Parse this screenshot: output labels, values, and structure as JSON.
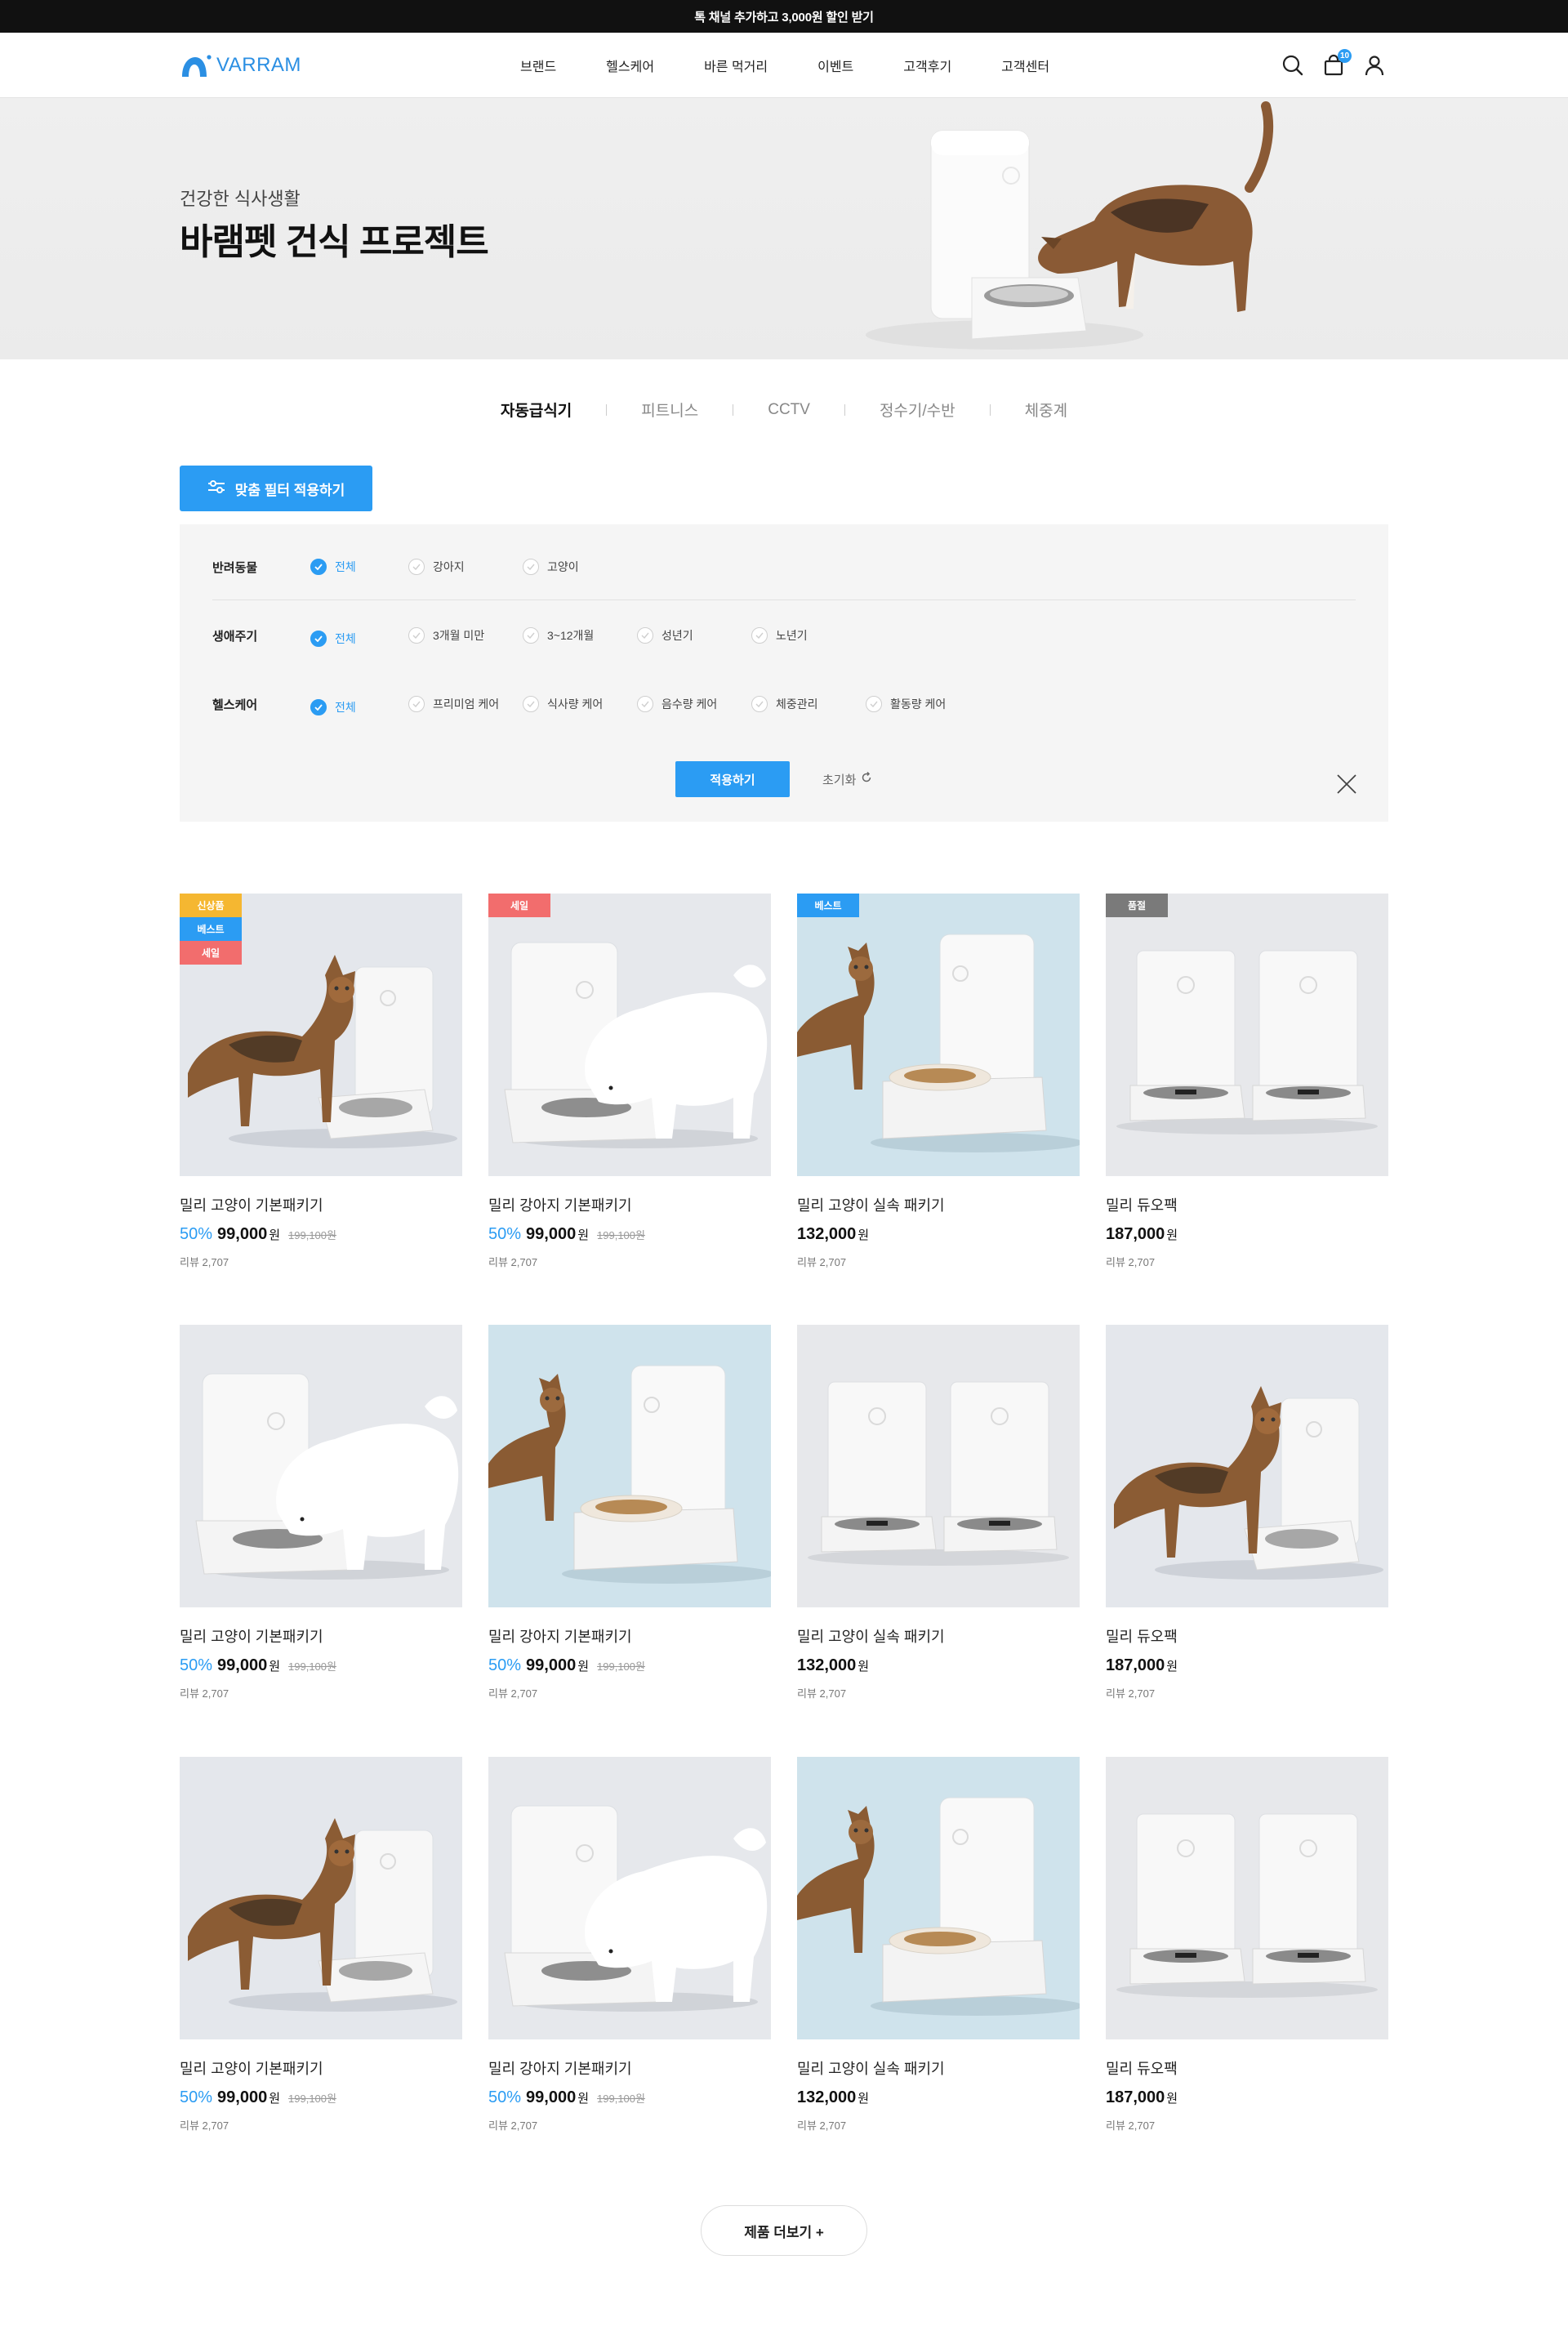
{
  "top_banner": {
    "text": "톡 채널 추가하고 3,000원 할인 받기"
  },
  "header": {
    "logo_text": "VARRAM",
    "nav": [
      "브랜드",
      "헬스케어",
      "바른 먹거리",
      "이벤트",
      "고객후기",
      "고객센터"
    ],
    "cart_count": "10"
  },
  "hero": {
    "subtitle": "건강한 식사생활",
    "title": "바램펫 건식 프로젝트"
  },
  "tabs": [
    {
      "label": "자동급식기",
      "active": true
    },
    {
      "label": "피트니스",
      "active": false
    },
    {
      "label": "CCTV",
      "active": false
    },
    {
      "label": "정수기/수반",
      "active": false
    },
    {
      "label": "체중계",
      "active": false
    }
  ],
  "filter_button": {
    "label": "맞춤 필터 적용하기"
  },
  "filter": {
    "rows": [
      {
        "label": "반려동물",
        "options": [
          {
            "label": "전체",
            "selected": true
          },
          {
            "label": "강아지",
            "selected": false
          },
          {
            "label": "고양이",
            "selected": false
          }
        ]
      },
      {
        "label": "생애주기",
        "options": [
          {
            "label": "전체",
            "selected": true
          },
          {
            "label": "3개월 미만",
            "selected": false
          },
          {
            "label": "3~12개월",
            "selected": false
          },
          {
            "label": "성년기",
            "selected": false
          },
          {
            "label": "노년기",
            "selected": false
          }
        ]
      },
      {
        "label": "헬스케어",
        "options": [
          {
            "label": "전체",
            "selected": true
          },
          {
            "label": "프리미엄 케어",
            "selected": false
          },
          {
            "label": "식사량 케어",
            "selected": false
          },
          {
            "label": "음수량 케어",
            "selected": false
          },
          {
            "label": "체중관리",
            "selected": false
          },
          {
            "label": "활동량 케어",
            "selected": false
          }
        ]
      }
    ],
    "apply_label": "적용하기",
    "reset_label": "초기화"
  },
  "badge_colors": {
    "신상품": "#f5b731",
    "베스트": "#2b9cf3",
    "세일": "#f26d6d",
    "품절": "#7a7a7a"
  },
  "products": [
    {
      "name": "밀리 고양이 기본패키기",
      "discount": "50%",
      "price": "99,000",
      "won": "원",
      "original": "199,100원",
      "review": "리뷰 2,707",
      "badges": [
        "신상품",
        "베스트",
        "세일"
      ],
      "image": "cat-feeder"
    },
    {
      "name": "밀리 강아지 기본패키기",
      "discount": "50%",
      "price": "99,000",
      "won": "원",
      "original": "199,100원",
      "review": "리뷰 2,707",
      "badges": [
        "세일"
      ],
      "image": "dog-feeder"
    },
    {
      "name": "밀리 고양이 실속 패키기",
      "discount": "",
      "price": "132,000",
      "won": "원",
      "original": "",
      "review": "리뷰 2,707",
      "badges": [
        "베스트"
      ],
      "image": "cat-blue"
    },
    {
      "name": "밀리 듀오팩",
      "discount": "",
      "price": "187,000",
      "won": "원",
      "original": "",
      "review": "리뷰 2,707",
      "badges": [
        "품절"
      ],
      "image": "duo"
    },
    {
      "name": "밀리 고양이 기본패키기",
      "discount": "50%",
      "price": "99,000",
      "won": "원",
      "original": "199,100원",
      "review": "리뷰 2,707",
      "badges": [],
      "image": "dog-feeder"
    },
    {
      "name": "밀리 강아지 기본패키기",
      "discount": "50%",
      "price": "99,000",
      "won": "원",
      "original": "199,100원",
      "review": "리뷰 2,707",
      "badges": [],
      "image": "cat-blue"
    },
    {
      "name": "밀리 고양이 실속 패키기",
      "discount": "",
      "price": "132,000",
      "won": "원",
      "original": "",
      "review": "리뷰 2,707",
      "badges": [],
      "image": "duo"
    },
    {
      "name": "밀리 듀오팩",
      "discount": "",
      "price": "187,000",
      "won": "원",
      "original": "",
      "review": "리뷰 2,707",
      "badges": [],
      "image": "cat-feeder"
    },
    {
      "name": "밀리 고양이 기본패키기",
      "discount": "50%",
      "price": "99,000",
      "won": "원",
      "original": "199,100원",
      "review": "리뷰 2,707",
      "badges": [],
      "image": "cat-feeder"
    },
    {
      "name": "밀리 강아지 기본패키기",
      "discount": "50%",
      "price": "99,000",
      "won": "원",
      "original": "199,100원",
      "review": "리뷰 2,707",
      "badges": [],
      "image": "dog-feeder"
    },
    {
      "name": "밀리 고양이 실속 패키기",
      "discount": "",
      "price": "132,000",
      "won": "원",
      "original": "",
      "review": "리뷰 2,707",
      "badges": [],
      "image": "cat-blue"
    },
    {
      "name": "밀리 듀오팩",
      "discount": "",
      "price": "187,000",
      "won": "원",
      "original": "",
      "review": "리뷰 2,707",
      "badges": [],
      "image": "duo"
    }
  ],
  "more_button": {
    "label": "제품 더보기 +"
  }
}
